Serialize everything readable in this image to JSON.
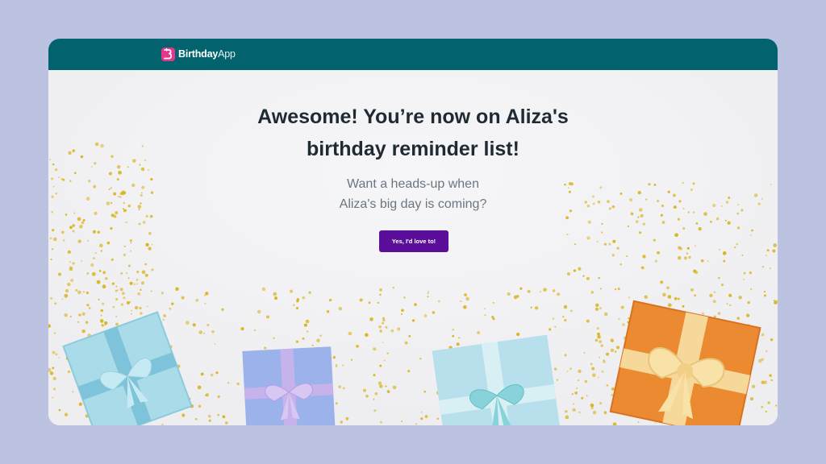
{
  "app": {
    "brand_bold": "Birthday",
    "brand_light": "App"
  },
  "main": {
    "headline_line1": "Awesome! You’re now on Aliza's",
    "headline_line2": "birthday reminder list!",
    "subtitle_line1": "Want a heads-up when",
    "subtitle_line2": "Aliza's big day is coming?",
    "cta_label": "Yes, I'd love to!"
  },
  "colors": {
    "page_bg": "#bcc3e1",
    "header_bg": "#02636f",
    "brand_accent": "#e8348a",
    "cta_bg": "#5a0e9a",
    "headline": "#1f2a33",
    "subtitle": "#6b7580"
  },
  "icons": {
    "logo": "birthday-app-logo-icon"
  }
}
